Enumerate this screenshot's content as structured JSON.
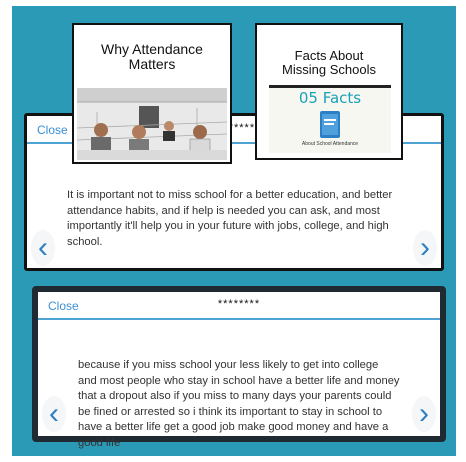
{
  "thumbnails": [
    {
      "title_line1": "Why Attendance",
      "title_line2": "Matters",
      "image_icon": "classroom-video-icon"
    },
    {
      "title_line1": "Facts About",
      "title_line2": "Missing Schools",
      "image_label": "05 Facts",
      "image_sub": "About School Attendance",
      "image_icon": "book-icon"
    }
  ],
  "panel1": {
    "close_label": "Close",
    "title": "********",
    "body": "It is important not to miss school for a better education, and better attendance habits, and if help is needed you can ask, and most importantly it'll help you in your future with jobs, college, and high school.",
    "prev_icon": "‹",
    "next_icon": "›"
  },
  "panel2": {
    "close_label": "Close",
    "title": "********",
    "body": "because if you miss school your less likely to get into college and most people who stay in school have a better life and money that a dropout also if you miss to many days your parents could be fined or arrested so i think its important to stay in school to have a better life get a good job make good money and have a good life",
    "prev_icon": "‹",
    "next_icon": "›"
  },
  "colors": {
    "background": "#2b9ab6",
    "accent": "#3a8fd3",
    "panel_border": "#111111"
  }
}
